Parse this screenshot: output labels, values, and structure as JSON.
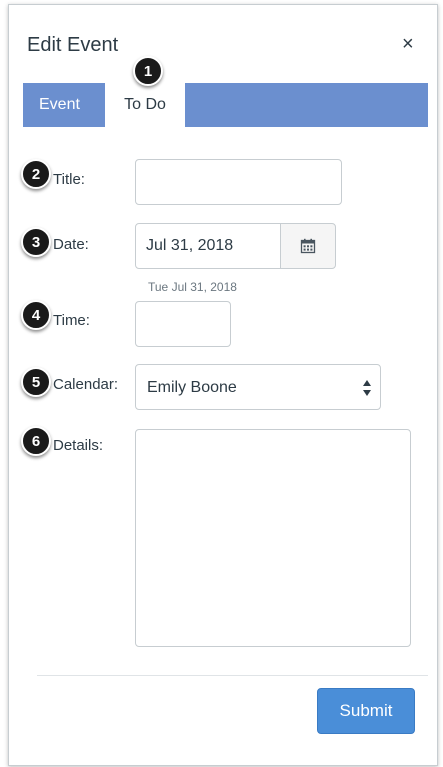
{
  "dialog": {
    "title": "Edit Event",
    "close_label": "×"
  },
  "tabs": [
    {
      "label": "Event"
    },
    {
      "label": "To Do"
    }
  ],
  "callouts": [
    "1",
    "2",
    "3",
    "4",
    "5",
    "6"
  ],
  "form": {
    "title_label": "Title:",
    "title_value": "",
    "date_label": "Date:",
    "date_value": "Jul 31, 2018",
    "date_hint": "Tue Jul 31, 2018",
    "time_label": "Time:",
    "time_value": "",
    "calendar_label": "Calendar:",
    "calendar_value": "Emily Boone",
    "details_label": "Details:",
    "details_value": ""
  },
  "actions": {
    "submit_label": "Submit"
  },
  "colors": {
    "tab_bar": "#6b8fcf",
    "submit": "#4a8ed8",
    "callout": "#1a1a1a"
  }
}
